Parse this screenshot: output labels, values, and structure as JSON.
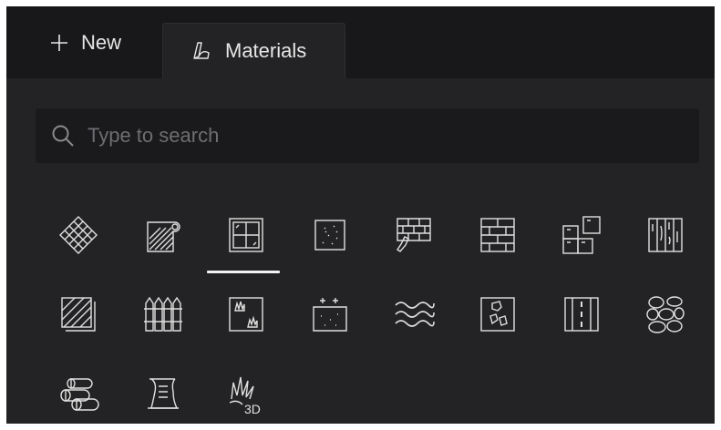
{
  "tabs": {
    "new_label": "New",
    "materials_label": "Materials",
    "active": "materials"
  },
  "search": {
    "placeholder": "Type to search",
    "value": ""
  },
  "categories": [
    {
      "icon": "diamond-lattice-icon"
    },
    {
      "icon": "roll-icon"
    },
    {
      "icon": "tile-window-icon",
      "selected": true
    },
    {
      "icon": "speckled-tile-icon"
    },
    {
      "icon": "brick-trowel-icon"
    },
    {
      "icon": "brick-wall-icon"
    },
    {
      "icon": "square-tiles-icon"
    },
    {
      "icon": "wood-planks-icon"
    },
    {
      "icon": "hatched-layers-icon"
    },
    {
      "icon": "picket-fence-icon"
    },
    {
      "icon": "grass-frame-icon"
    },
    {
      "icon": "sparkle-ground-icon"
    },
    {
      "icon": "water-waves-icon"
    },
    {
      "icon": "stone-paving-icon"
    },
    {
      "icon": "road-icon"
    },
    {
      "icon": "cobblestone-icon"
    },
    {
      "icon": "fabric-rolls-icon"
    },
    {
      "icon": "scroll-icon"
    },
    {
      "icon": "grass-3d-icon",
      "label": "3D"
    }
  ],
  "colors": {
    "background": "#232325",
    "tabbar": "#18181a",
    "search_background": "#1a1a1c",
    "icon_stroke": "#e0e0e0",
    "text": "#e6e6e6",
    "placeholder": "#6e6e72"
  }
}
